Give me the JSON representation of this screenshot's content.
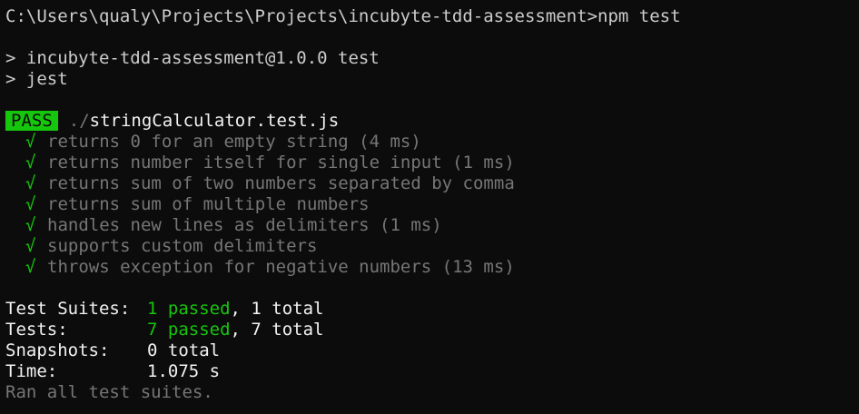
{
  "terminal": {
    "prompt_line": "C:\\Users\\qualy\\Projects\\Projects\\incubyte-tdd-assessment>npm test",
    "script_lines": [
      "> incubyte-tdd-assessment@1.0.0 test",
      "> jest"
    ],
    "result": {
      "badge": "PASS",
      "path_dim": "./",
      "file": "stringCalculator.test.js"
    },
    "tests": [
      {
        "check": "√",
        "name": "returns 0 for an empty string (4 ms)"
      },
      {
        "check": "√",
        "name": "returns number itself for single input (1 ms)"
      },
      {
        "check": "√",
        "name": "returns sum of two numbers separated by comma"
      },
      {
        "check": "√",
        "name": "returns sum of multiple numbers"
      },
      {
        "check": "√",
        "name": "handles new lines as delimiters (1 ms)"
      },
      {
        "check": "√",
        "name": "supports custom delimiters"
      },
      {
        "check": "√",
        "name": "throws exception for negative numbers (13 ms)"
      }
    ],
    "summary": {
      "suites": {
        "label": "Test Suites:",
        "passed": "1 passed",
        "rest": ", 1 total"
      },
      "tests": {
        "label": "Tests:",
        "passed": "7 passed",
        "rest": ", 7 total"
      },
      "snapshots": {
        "label": "Snapshots:",
        "value": "0 total"
      },
      "time": {
        "label": "Time:",
        "value": "1.075 s"
      }
    },
    "footer": "Ran all test suites.",
    "colors": {
      "background": "#0c0c0c",
      "pass_green": "#16c60c",
      "text": "#cccccc",
      "dim": "#767676"
    }
  }
}
